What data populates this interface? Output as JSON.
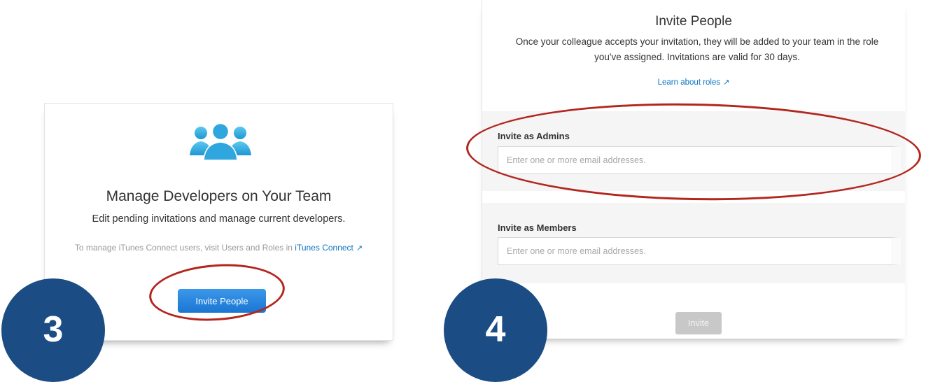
{
  "colors": {
    "link": "#0a75c2",
    "primary_button": "#1a76d1",
    "annotation_oval": "#b3261e",
    "badge": "#1b4c83",
    "icon": "#33aee0"
  },
  "step3": {
    "badge_number": "3",
    "icon": "team-people-icon",
    "title": "Manage Developers on Your Team",
    "subtitle": "Edit pending invitations and manage current developers.",
    "itc_text": "To manage iTunes Connect users, visit Users and Roles in",
    "itc_link": "iTunes Connect",
    "itc_link_icon": "external-arrow-icon",
    "ext_arrow_glyph": "↗",
    "invite_button": "Invite People"
  },
  "step4": {
    "badge_number": "4",
    "title": "Invite People",
    "description": "Once your colleague accepts your invitation, they will be added to your team in the role you've assigned. Invitations are valid for 30 days.",
    "learn_link": "Learn about roles",
    "learn_link_icon": "external-arrow-icon",
    "ext_arrow_glyph": "↗",
    "admins_label": "Invite as Admins",
    "admins_placeholder": "Enter one or more email addresses.",
    "members_label": "Invite as Members",
    "members_placeholder": "Enter one or more email addresses.",
    "invite_button": "Invite"
  }
}
